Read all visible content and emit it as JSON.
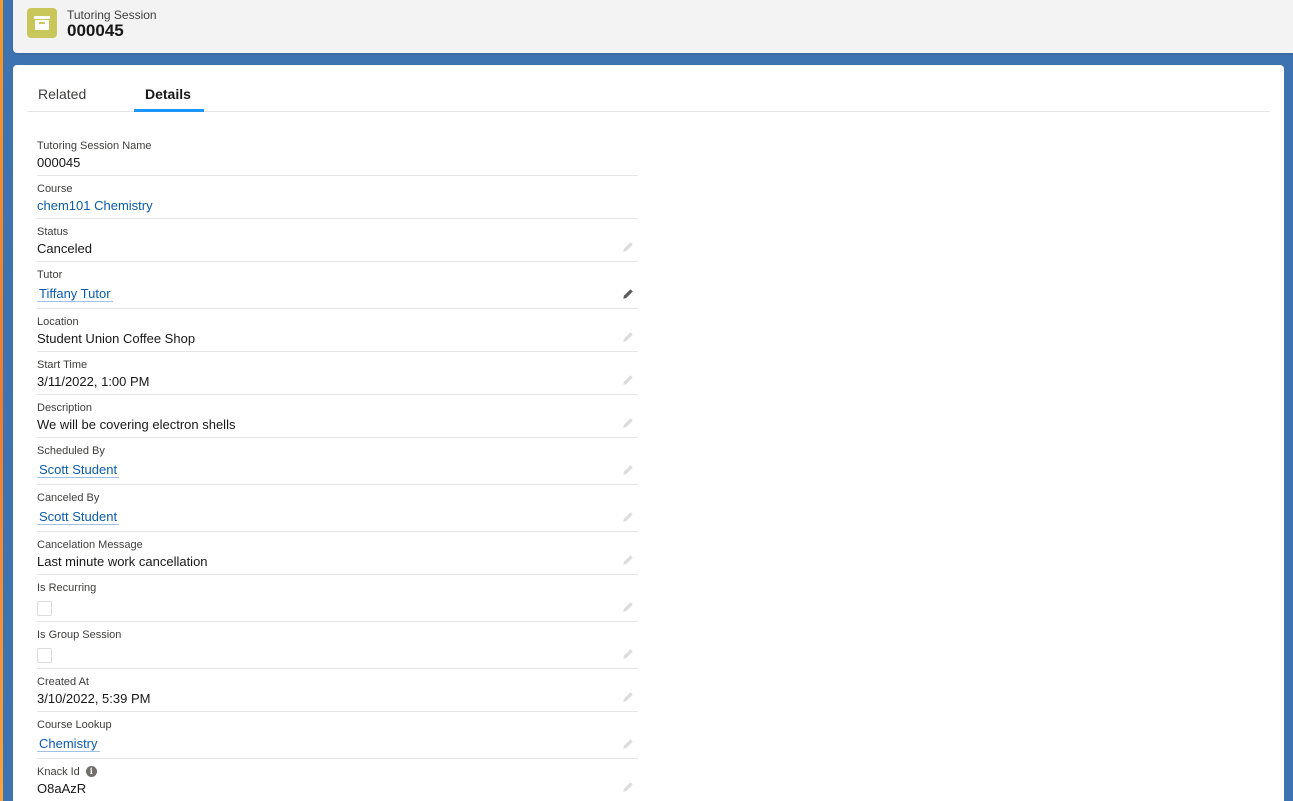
{
  "header": {
    "object_type": "Tutoring Session",
    "record_name": "000045"
  },
  "tabs": [
    {
      "label": "Related",
      "active": false
    },
    {
      "label": "Details",
      "active": true
    }
  ],
  "colors": {
    "accent": "#1b96ff",
    "link": "#0b5cab",
    "object_icon": "#c9c759"
  },
  "fields": [
    {
      "label": "Tutoring Session Name",
      "value": "000045",
      "type": "text",
      "editable": false
    },
    {
      "label": "Course",
      "value": "chem101 Chemistry",
      "type": "link",
      "editable": false
    },
    {
      "label": "Status",
      "value": "Canceled",
      "type": "text",
      "editable": true
    },
    {
      "label": "Tutor",
      "value": "Tiffany Tutor",
      "type": "lookup",
      "editable": true,
      "hover": true
    },
    {
      "label": "Location",
      "value": "Student Union Coffee Shop",
      "type": "text",
      "editable": true
    },
    {
      "label": "Start Time",
      "value": "3/11/2022, 1:00 PM",
      "type": "text",
      "editable": true
    },
    {
      "label": "Description",
      "value": "We will be covering electron shells",
      "type": "text",
      "editable": true
    },
    {
      "label": "Scheduled By",
      "value": "Scott Student",
      "type": "lookup",
      "editable": true
    },
    {
      "label": "Canceled By",
      "value": "Scott Student",
      "type": "lookup",
      "editable": true
    },
    {
      "label": "Cancelation Message",
      "value": "Last minute work cancellation",
      "type": "text",
      "editable": true
    },
    {
      "label": "Is Recurring",
      "value": false,
      "type": "checkbox",
      "editable": true
    },
    {
      "label": "Is Group Session",
      "value": false,
      "type": "checkbox",
      "editable": true
    },
    {
      "label": "Created At",
      "value": "3/10/2022, 5:39 PM",
      "type": "text",
      "editable": true
    },
    {
      "label": "Course Lookup",
      "value": "Chemistry",
      "type": "lookup",
      "editable": true
    },
    {
      "label": "Knack Id",
      "value": "O8aAzR",
      "type": "text",
      "editable": true,
      "info": true
    }
  ],
  "icons": {
    "object": "archive-box-icon",
    "edit": "pencil-icon",
    "info": "info-icon"
  }
}
